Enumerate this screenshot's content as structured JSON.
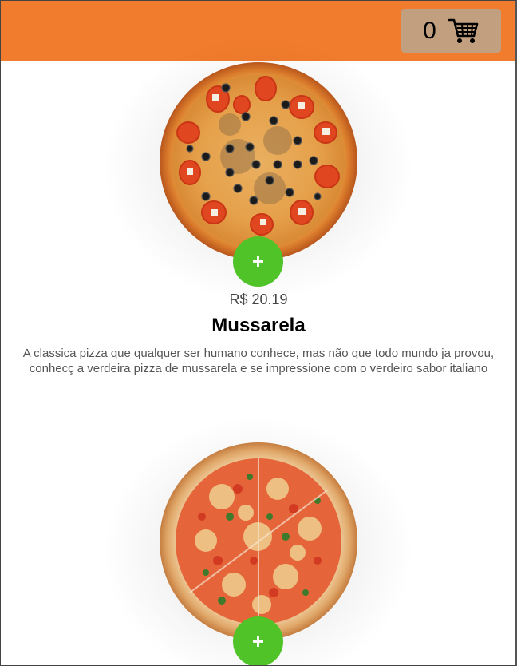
{
  "header": {
    "background": "#f27c2d"
  },
  "cart": {
    "count": "0",
    "icon": "shopping-cart-icon",
    "background": "#c2a07f"
  },
  "accent_green": "#4fc327",
  "products": [
    {
      "add_label": "+",
      "price": "R$ 20.19",
      "name": "Mussarela",
      "description": "A classica pizza que qualquer ser humano conhece, mas não que todo mundo ja provou, conhecç a verdeira pizza de mussarela e se impressione com o verdeiro sabor italiano"
    },
    {
      "add_label": "+"
    }
  ]
}
